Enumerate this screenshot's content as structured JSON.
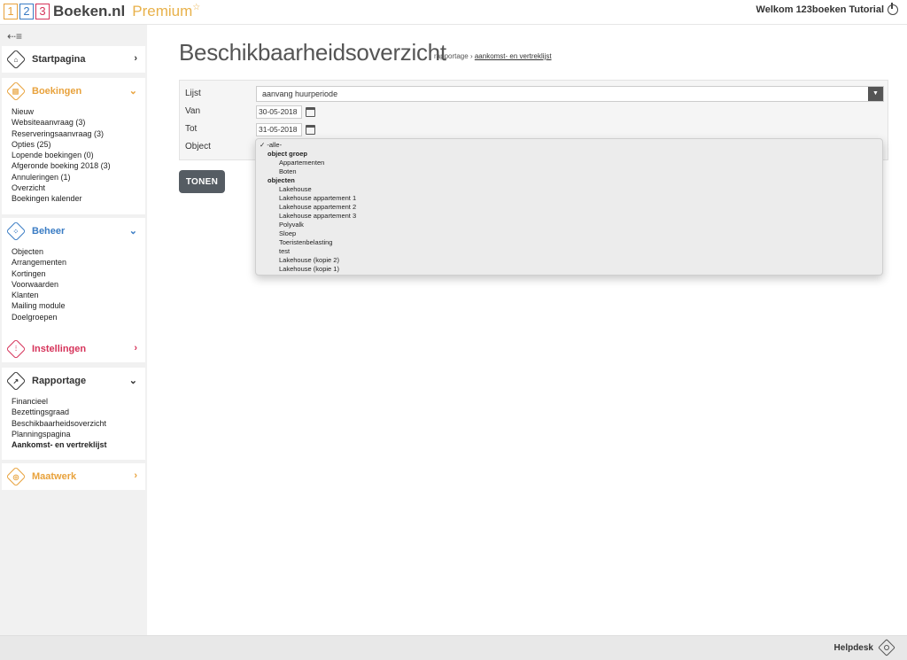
{
  "header": {
    "logo_digits": [
      "1",
      "2",
      "3"
    ],
    "brand": "Boeken.nl",
    "premium": "Premium",
    "star": "☆",
    "welcome": "Welkom 123boeken Tutorial"
  },
  "sidebar": {
    "collapse_icon": "⇠≡",
    "panels": {
      "start": {
        "label": "Startpagina",
        "icon": "home-icon",
        "chevron": "›"
      },
      "boekingen": {
        "label": "Boekingen",
        "icon": "booking-icon",
        "chevron": "⌄",
        "items": [
          "Nieuw",
          "Websiteaanvraag (3)",
          "Reserveringsaanvraag (3)",
          "Opties (25)",
          "Lopende boekingen (0)",
          "Afgeronde boeking 2018 (3)",
          "Annuleringen (1)",
          "Overzicht",
          "Boekingen kalender"
        ]
      },
      "beheer": {
        "label": "Beheer",
        "icon": "manage-icon",
        "chevron": "⌄",
        "items": [
          "Objecten",
          "Arrangementen",
          "Kortingen",
          "Voorwaarden",
          "Klanten",
          "Mailing module",
          "Doelgroepen"
        ]
      },
      "instellingen": {
        "label": "Instellingen",
        "icon": "settings-icon",
        "chevron": "›"
      },
      "rapportage": {
        "label": "Rapportage",
        "icon": "report-icon",
        "chevron": "⌄",
        "items": [
          "Financieel",
          "Bezettingsgraad",
          "Beschikbaarheidsoverzicht",
          "Planningspagina",
          "Aankomst- en vertreklijst"
        ]
      },
      "maatwerk": {
        "label": "Maatwerk",
        "icon": "custom-icon",
        "chevron": "›"
      }
    }
  },
  "main": {
    "title": "Beschikbaarheidsoverzicht",
    "breadcrumb": {
      "parent": "rapportage",
      "separator": "›",
      "current": "aankomst- en vertreklijst"
    },
    "form": {
      "lijst_label": "Lijst",
      "lijst_value": "aanvang huurperiode",
      "van_label": "Van",
      "van_value": "30-05-2018",
      "tot_label": "Tot",
      "tot_value": "31-05-2018",
      "object_label": "Object"
    },
    "button": "TONEN",
    "dropdown": {
      "selected": "-alle-",
      "check": "✓",
      "group1": "object groep",
      "group1_items": [
        "Appartementen",
        "Boten"
      ],
      "group2": "objecten",
      "group2_items": [
        "Lakehouse",
        "Lakehouse appartement 1",
        "Lakehouse appartement 2",
        "Lakehouse appartement 3",
        "Polyvalk",
        "Sloep",
        "Toeristenbelasting",
        "test",
        "Lakehouse (kopie 2)",
        "Lakehouse (kopie 1)"
      ]
    }
  },
  "footer": {
    "helpdesk": "Helpdesk"
  },
  "colors": {
    "orange": "#e8a23c",
    "blue": "#3a7cc4",
    "red": "#d6335a",
    "dark": "#333333"
  }
}
